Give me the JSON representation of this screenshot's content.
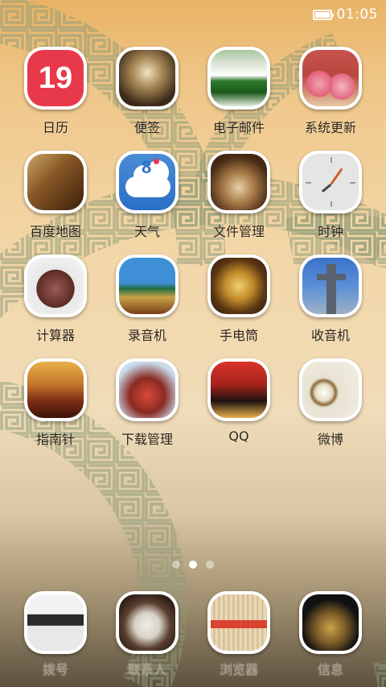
{
  "status_bar": {
    "time": "01:05",
    "battery_icon": "battery-full-icon"
  },
  "apps": [
    {
      "name": "calendar",
      "label": "日历",
      "badge": "19"
    },
    {
      "name": "notes",
      "label": "便签"
    },
    {
      "name": "email",
      "label": "电子邮件"
    },
    {
      "name": "system-update",
      "label": "系统更新"
    },
    {
      "name": "baidu-map",
      "label": "百度地图"
    },
    {
      "name": "weather",
      "label": "天气",
      "temp": "8"
    },
    {
      "name": "file-manager",
      "label": "文件管理"
    },
    {
      "name": "clock",
      "label": "时钟"
    },
    {
      "name": "calculator",
      "label": "计算器"
    },
    {
      "name": "recorder",
      "label": "录音机"
    },
    {
      "name": "flashlight",
      "label": "手电筒"
    },
    {
      "name": "radio",
      "label": "收音机"
    },
    {
      "name": "compass",
      "label": "指南针"
    },
    {
      "name": "download-manager",
      "label": "下载管理"
    },
    {
      "name": "qq",
      "label": "QQ"
    },
    {
      "name": "weibo",
      "label": "微博"
    }
  ],
  "page_indicator": {
    "count": 3,
    "active_index": 1
  },
  "dock": [
    {
      "name": "dialer",
      "label": "拨号"
    },
    {
      "name": "contacts",
      "label": "联系人"
    },
    {
      "name": "browser",
      "label": "浏览器"
    },
    {
      "name": "messages",
      "label": "信息"
    }
  ],
  "colors": {
    "calendar_red": "#e8394a",
    "weather_blue": "#2a6fc7",
    "label_text": "#2d2216"
  }
}
